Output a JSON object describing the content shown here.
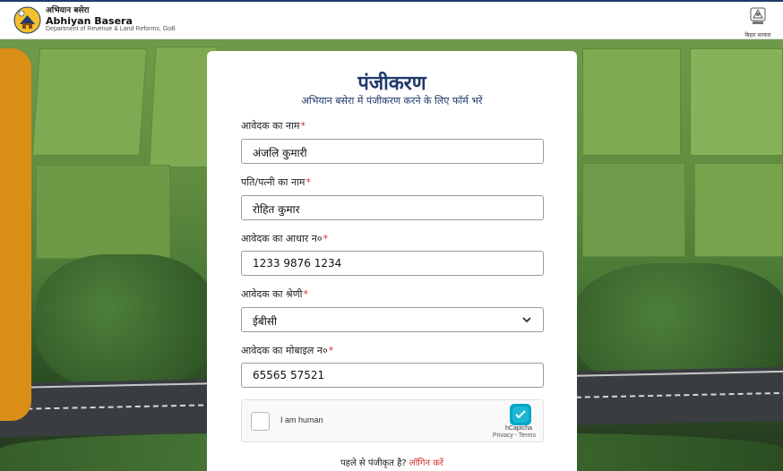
{
  "header": {
    "brand_hindi": "अभियान बसेरा",
    "brand_english": "Abhiyan Basera",
    "department": "Department of Revenue & Land Reforms, GoB",
    "gov_text": "बिहार सरकार"
  },
  "form": {
    "title": "पंजीकरण",
    "subtitle": "अभियान बसेरा में पंजीकरण करने के लिए फॉर्म भरें",
    "fields": {
      "name": {
        "label": "आवेदक का नाम",
        "value": "अंजलि कुमारी"
      },
      "spouse": {
        "label": "पति/पत्नी का नाम",
        "value": "रोहित कुमार"
      },
      "aadhaar": {
        "label": "आवेदक का आधार न०",
        "value": "1233 9876 1234"
      },
      "category": {
        "label": "आवेदक का श्रेणी",
        "value": "ईबीसी"
      },
      "mobile": {
        "label": "आवेदक का मोबाइल न०",
        "value": "65565 57521"
      }
    },
    "required_mark": "*",
    "captcha": {
      "checkbox_label": "I am human",
      "brand": "hCaptcha",
      "links": "Privacy - Terms"
    },
    "login_prompt": "पहले से पंजीकृत है?",
    "login_link": "लॉगिन करें"
  },
  "colors": {
    "primary": "#1f3a6b",
    "accent": "#d98e16",
    "required": "#d32f2f"
  }
}
